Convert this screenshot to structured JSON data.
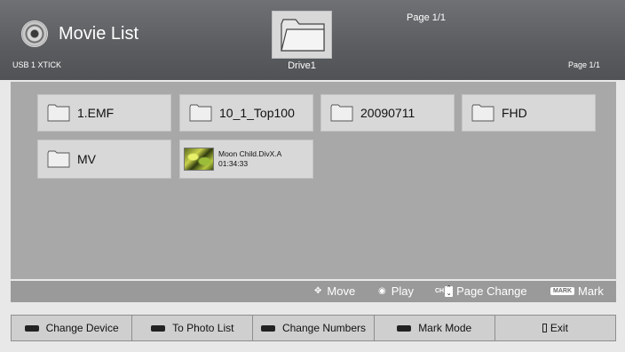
{
  "header": {
    "title": "Movie List",
    "device_label": "USB 1 XTICK",
    "drive_label": "Drive1",
    "page_top": "Page 1/1",
    "page_right": "Page 1/1"
  },
  "items": [
    {
      "type": "folder",
      "label": "1.EMF"
    },
    {
      "type": "folder",
      "label": "10_1_Top100"
    },
    {
      "type": "folder",
      "label": "20090711"
    },
    {
      "type": "folder",
      "label": "FHD"
    },
    {
      "type": "folder",
      "label": "MV"
    },
    {
      "type": "video",
      "label": "Moon Child.DivX.A",
      "duration": "01:34:33"
    }
  ],
  "hints": {
    "move": "Move",
    "play": "Play",
    "ch_key": "CH",
    "page_change": "Page Change",
    "mark_key": "MARK",
    "mark": "Mark"
  },
  "buttons": [
    {
      "label": "Change Device",
      "key_color": "#222222"
    },
    {
      "label": "To Photo List",
      "key_color": "#222222"
    },
    {
      "label": "Change Numbers",
      "key_color": "#222222"
    },
    {
      "label": "Mark Mode",
      "key_color": "#222222"
    },
    {
      "label": "Exit",
      "icon": "exit-icon"
    }
  ],
  "colors": {
    "header_bg": "#5a5c5f",
    "content_bg": "#a8a8a8",
    "item_bg": "#d8d8d8",
    "button_bg": "#cfcfcf"
  }
}
